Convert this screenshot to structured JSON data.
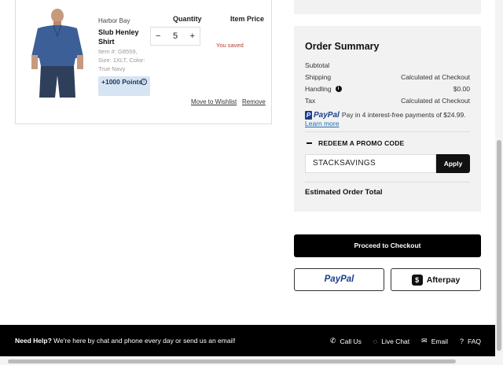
{
  "cart_item": {
    "brand": "Harbor Bay",
    "name": "Slub Henley Shirt",
    "item_number": "Item #: G8559,",
    "size_color": "Size: 1XLT, Color: True Navy",
    "points": "+1000 Points",
    "quantity_header": "Quantity",
    "price_header": "Item Price",
    "quantity": "5",
    "minus_glyph": "−",
    "plus_glyph": "+",
    "you_saved": "You saved",
    "move_to_wishlist": "Move to Wishlist",
    "remove": "Remove"
  },
  "summary": {
    "title": "Order Summary",
    "rows": [
      {
        "label": "Subtotal",
        "value": ""
      },
      {
        "label": "Shipping",
        "value": "Calculated at Checkout"
      },
      {
        "label": "Handling",
        "value": "$0.00"
      },
      {
        "label": "Tax",
        "value": "Calculated at Checkout"
      }
    ],
    "paypal_logo": "PayPal",
    "paypal_text": "Pay in 4 interest-free payments of $24.99.",
    "learn_more": "Learn more",
    "promo_label": "REDEEM A PROMO CODE",
    "promo_code": "STACKSAVINGS",
    "apply": "Apply",
    "estimated_total": "Estimated Order Total"
  },
  "actions": {
    "checkout": "Proceed to Checkout",
    "paypal": "PayPal",
    "afterpay": "Afterpay"
  },
  "footer": {
    "need_help": "Need Help?",
    "help_text": "We're here by chat and phone every day or send us an email!",
    "links": [
      "Call Us",
      "Live Chat",
      "Email",
      "FAQ"
    ]
  },
  "colors": {
    "saved_red": "#c0392b",
    "points_bg": "#d6e4f4",
    "paypal_dark": "#1a3f8f",
    "paypal_light": "#1e8ad6"
  }
}
